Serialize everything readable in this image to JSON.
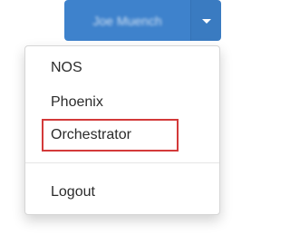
{
  "header": {
    "user_name": "Joe Muench"
  },
  "menu": {
    "items": [
      {
        "label": "NOS"
      },
      {
        "label": "Phoenix"
      },
      {
        "label": "Orchestrator",
        "highlighted": true
      },
      {
        "label": "Logout"
      }
    ]
  },
  "icons": {
    "toggle": "caret-down-icon"
  },
  "colors": {
    "button_primary": "#3e82cc",
    "highlight_border": "#d33a3a"
  }
}
